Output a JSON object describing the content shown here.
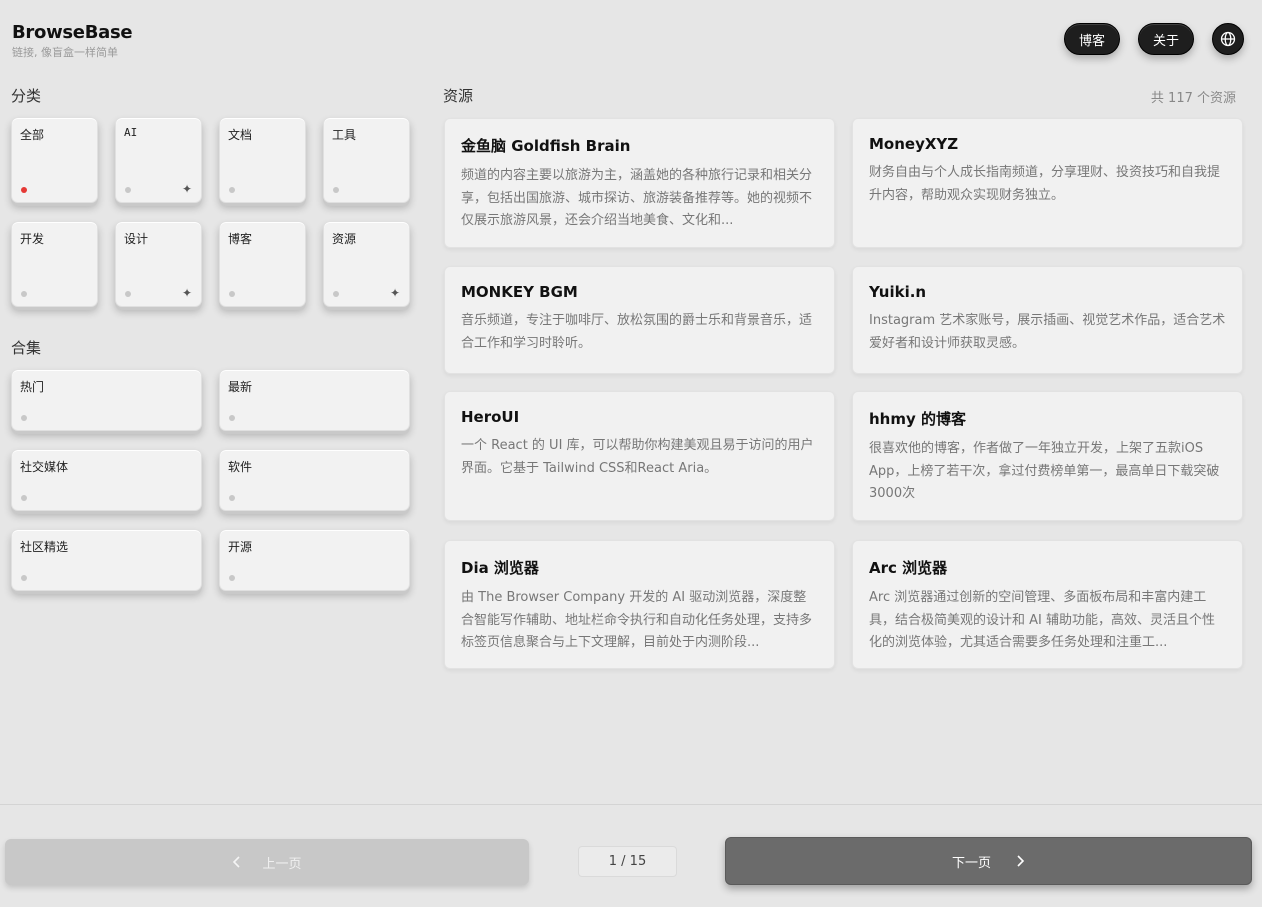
{
  "header": {
    "brand": "BrowseBase",
    "tagline": "链接, 像盲盒一样简单"
  },
  "nav": {
    "blog_label": "博客",
    "about_label": "关于"
  },
  "categories": {
    "title": "分类",
    "items": [
      {
        "label": "全部",
        "active": true,
        "spark": false
      },
      {
        "label": "AI",
        "active": false,
        "spark": true
      },
      {
        "label": "文档",
        "active": false,
        "spark": false
      },
      {
        "label": "工具",
        "active": false,
        "spark": false
      },
      {
        "label": "开发",
        "active": false,
        "spark": false
      },
      {
        "label": "设计",
        "active": false,
        "spark": true
      },
      {
        "label": "博客",
        "active": false,
        "spark": false
      },
      {
        "label": "资源",
        "active": false,
        "spark": true
      }
    ]
  },
  "collections": {
    "title": "合集",
    "items": [
      {
        "label": "热门"
      },
      {
        "label": "最新"
      },
      {
        "label": "社交媒体"
      },
      {
        "label": "软件"
      },
      {
        "label": "社区精选"
      },
      {
        "label": "开源"
      }
    ]
  },
  "resources": {
    "title": "资源",
    "count": "共 117 个资源",
    "cards": [
      {
        "title": "金鱼脑 Goldfish Brain",
        "desc": "频道的内容主要以旅游为主，涵盖她的各种旅行记录和相关分享，包括出国旅游、城市探访、旅游装备推荐等。她的视频不仅展示旅游风景，还会介绍当地美食、文化和..."
      },
      {
        "title": "MoneyXYZ",
        "desc": "财务自由与个人成长指南频道，分享理财、投资技巧和自我提升内容，帮助观众实现财务独立。"
      },
      {
        "title": "MONKEY BGM",
        "desc": "音乐频道，专注于咖啡厅、放松氛围的爵士乐和背景音乐，适合工作和学习时聆听。"
      },
      {
        "title": "Yuiki.n",
        "desc": "Instagram 艺术家账号，展示插画、视觉艺术作品，适合艺术爱好者和设计师获取灵感。"
      },
      {
        "title": "HeroUI",
        "desc": "一个 React 的 UI 库，可以帮助你构建美观且易于访问的用户界面。它基于 Tailwind CSS和React Aria。"
      },
      {
        "title": "hhmy 的博客",
        "desc": "很喜欢他的博客，作者做了一年独立开发，上架了五款iOS App，上榜了若干次，拿过付费榜单第一，最高单日下载突破3000次"
      },
      {
        "title": "Dia 浏览器",
        "desc": "由 The Browser Company 开发的 AI 驱动浏览器，深度整合智能写作辅助、地址栏命令执行和自动化任务处理，支持多标签页信息聚合与上下文理解，目前处于内测阶段..."
      },
      {
        "title": "Arc 浏览器",
        "desc": "Arc 浏览器通过创新的空间管理、多面板布局和丰富内建工具，结合极简美观的设计和 AI 辅助功能，高效、灵活且个性化的浏览体验，尤其适合需要多任务处理和注重工..."
      }
    ]
  },
  "pagination": {
    "prev_label": "上一页",
    "next_label": "下一页",
    "page": "1 / 15"
  }
}
